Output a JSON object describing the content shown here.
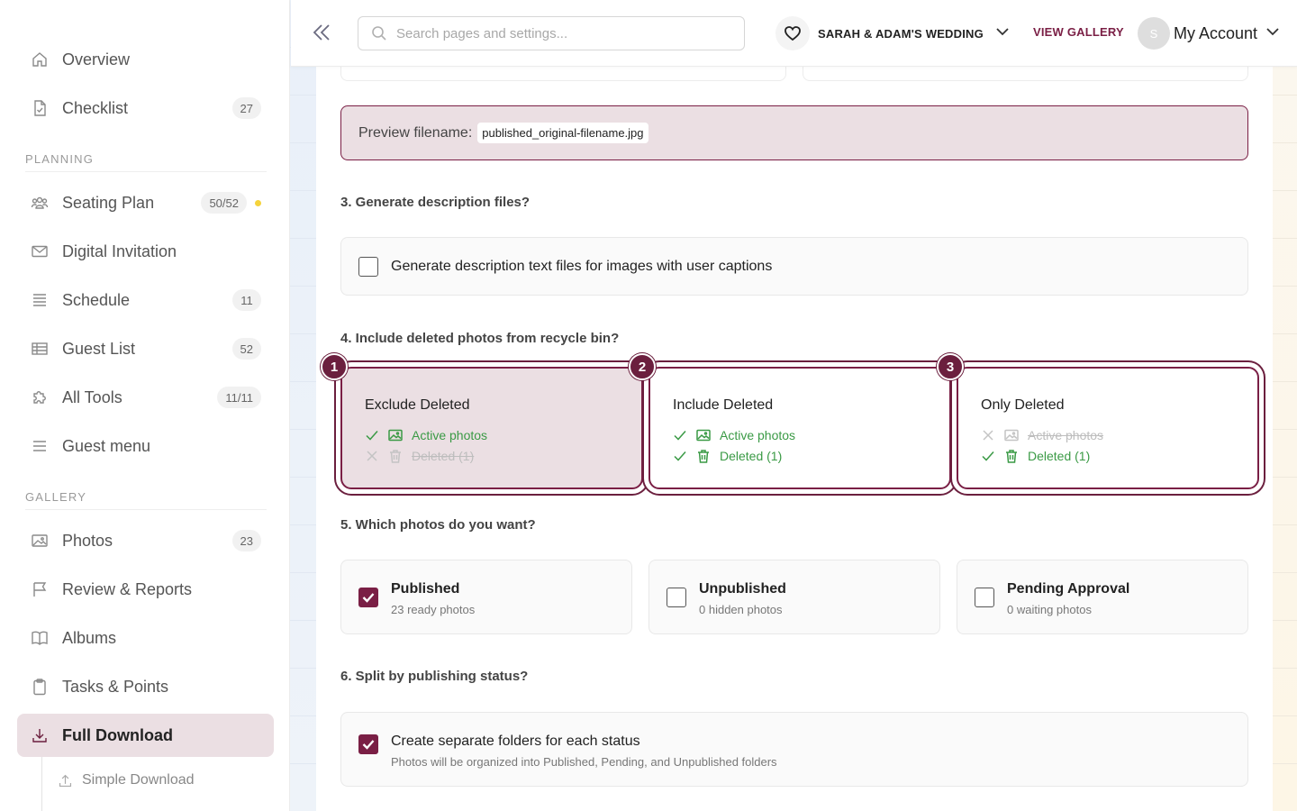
{
  "sidebar": {
    "items": [
      {
        "label": "Overview",
        "icon": "home-icon"
      },
      {
        "label": "Checklist",
        "badge": "27",
        "icon": "checklist-icon"
      },
      {
        "label": "Seating Plan",
        "badge": "50/52",
        "icon": "people-icon"
      },
      {
        "label": "Digital Invitation",
        "icon": "envelope-icon"
      },
      {
        "label": "Schedule",
        "badge": "11",
        "icon": "schedule-icon"
      },
      {
        "label": "Guest List",
        "badge": "52",
        "icon": "table-icon"
      },
      {
        "label": "All Tools",
        "badge": "11/11",
        "icon": "puzzle-icon"
      },
      {
        "label": "Guest menu",
        "icon": "menu-icon"
      },
      {
        "label": "Photos",
        "badge": "23",
        "icon": "image-icon"
      },
      {
        "label": "Review & Reports",
        "icon": "flag-icon"
      },
      {
        "label": "Albums",
        "icon": "book-icon"
      },
      {
        "label": "Tasks & Points",
        "icon": "clipboard-icon"
      },
      {
        "label": "Full Download",
        "icon": "download-icon"
      }
    ],
    "sections": {
      "planning": "PLANNING",
      "gallery": "GALLERY"
    },
    "sub_item": "Simple Download"
  },
  "topbar": {
    "search_placeholder": "Search pages and settings...",
    "event_name": "SARAH & ADAM'S WEDDING",
    "view_gallery": "VIEW GALLERY",
    "avatar_initial": "S",
    "account": "My Account"
  },
  "main": {
    "preview_label": "Preview filename:",
    "preview_value": "published_original-filename.jpg",
    "q3": "3. Generate description files?",
    "q3_option": "Generate description text files for images with user captions",
    "q4": "4. Include deleted photos from recycle bin?",
    "q4_options": [
      {
        "num": "1",
        "title": "Exclude Deleted",
        "active": "Active photos",
        "deleted": "Deleted (1)"
      },
      {
        "num": "2",
        "title": "Include Deleted",
        "active": "Active photos",
        "deleted": "Deleted (1)"
      },
      {
        "num": "3",
        "title": "Only Deleted",
        "active": "Active photos",
        "deleted": "Deleted (1)"
      }
    ],
    "q5": "5. Which photos do you want?",
    "q5_options": [
      {
        "title": "Published",
        "sub": "23 ready photos",
        "checked": true
      },
      {
        "title": "Unpublished",
        "sub": "0 hidden photos",
        "checked": false
      },
      {
        "title": "Pending Approval",
        "sub": "0 waiting photos",
        "checked": false
      }
    ],
    "q6": "6. Split by publishing status?",
    "q6_title": "Create separate folders for each status",
    "q6_sub": "Photos will be organized into Published, Pending, and Unpublished folders"
  },
  "colors": {
    "accent": "#7a1f45",
    "accent_bg": "#ebdfe3",
    "success": "#3a9a45"
  }
}
